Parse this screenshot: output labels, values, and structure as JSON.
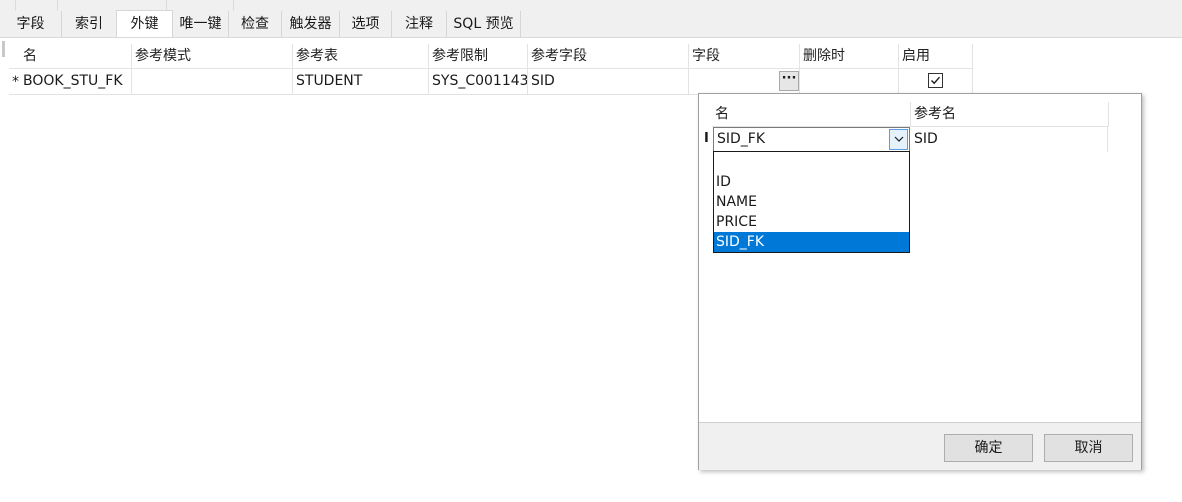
{
  "tabs": [
    {
      "label": "字段",
      "active": false
    },
    {
      "label": "索引",
      "active": false
    },
    {
      "label": "外键",
      "active": true
    },
    {
      "label": "唯一键",
      "active": false
    },
    {
      "label": "检查",
      "active": false
    },
    {
      "label": "触发器",
      "active": false
    },
    {
      "label": "选项",
      "active": false
    },
    {
      "label": "注释",
      "active": false
    },
    {
      "label": "SQL 预览",
      "active": false
    }
  ],
  "grid": {
    "columns": [
      "名",
      "参考模式",
      "参考表",
      "参考限制",
      "参考字段",
      "字段",
      "删除时",
      "启用"
    ],
    "rows": [
      {
        "marker": "*",
        "name": "BOOK_STU_FK",
        "ref_schema": "",
        "ref_table": "STUDENT",
        "ref_constraint": "SYS_C001143",
        "ref_field": "SID",
        "field": "",
        "on_delete": "",
        "enabled": true,
        "field_button_label": "···"
      }
    ]
  },
  "popup": {
    "columns": [
      "名",
      "参考名"
    ],
    "row": {
      "marker": "I",
      "name": "SID_FK",
      "ref_name": "SID"
    },
    "dropdown_options": [
      "",
      "ID",
      "NAME",
      "PRICE",
      "SID_FK"
    ],
    "selected_option": "SID_FK",
    "ok_label": "确定",
    "cancel_label": "取消"
  },
  "colors": {
    "selection": "#0078d7",
    "tabbar_bg": "#f0f0f0"
  },
  "icons": {
    "combo_arrow": "chevron-down-icon",
    "checkbox": "checkmark-icon"
  }
}
